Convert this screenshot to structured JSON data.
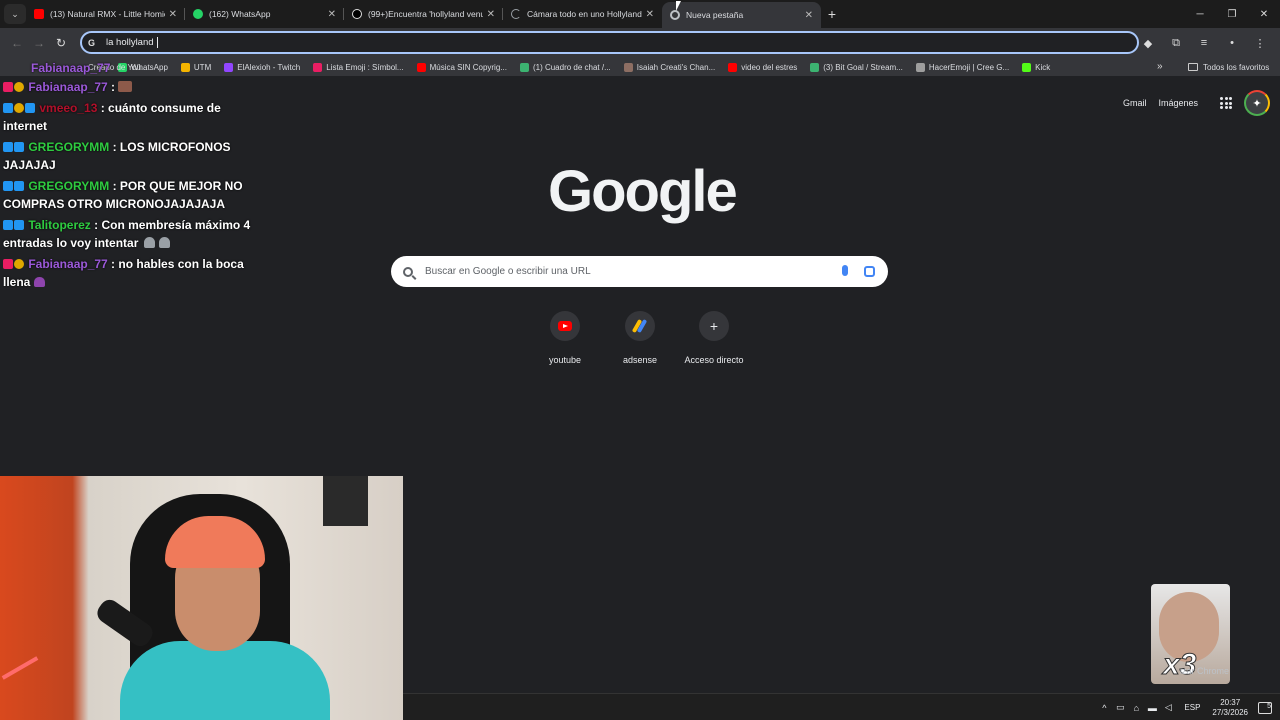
{
  "tabs": [
    {
      "label": "(13) Natural RMX - Little Homie",
      "icon": "youtube-icon",
      "color": "#ff0000"
    },
    {
      "label": "(162) WhatsApp",
      "icon": "whatsapp-icon",
      "color": "#25d366"
    },
    {
      "label": "(99+)Encuentra 'hollyland venu",
      "icon": "tiktok-icon",
      "color": "#ffffff"
    },
    {
      "label": "Cámara todo en uno Hollyland",
      "icon": "loading-icon",
      "color": "#9aa0a6"
    },
    {
      "label": "Nueva pestaña",
      "icon": "chrome-icon",
      "color": "#bdc1c6"
    }
  ],
  "omnibox": {
    "value": "la hollyland"
  },
  "bookmarks": [
    {
      "label": "WhatsApp",
      "color": "#25d366"
    },
    {
      "label": "UTM",
      "color": "#f4b400"
    },
    {
      "label": "ElAlexioh - Twitch",
      "color": "#9146ff"
    },
    {
      "label": "Lista Emoji : Símbol...",
      "color": "#e91e63"
    },
    {
      "label": "Música SIN Copyrig...",
      "color": "#ff0000"
    },
    {
      "label": "(1) Cuadro de chat /...",
      "color": "#3cb371"
    },
    {
      "label": "Isaiah Creati's Chan...",
      "color": "#8d6e63"
    },
    {
      "label": "video del estres",
      "color": "#ff0000"
    },
    {
      "label": "(3) Bit Goal / Stream...",
      "color": "#3cb371"
    },
    {
      "label": "HacerEmoji | Cree G...",
      "color": "#9e9e9e"
    },
    {
      "label": "Kick",
      "color": "#53fc18"
    }
  ],
  "bookmark_chat_prefix": "Fabianaap_77",
  "bookmark_chat_trail": "Creado de You...",
  "all_bookmarks": "Todos los favoritos",
  "ntp": {
    "gmail": "Gmail",
    "images": "Imágenes",
    "logo": "Google",
    "search_placeholder": "Buscar en Google o escribir una URL",
    "shortcuts": [
      {
        "label": "youtube"
      },
      {
        "label": "adsense"
      },
      {
        "label": "Acceso directo",
        "symbol": "+"
      }
    ]
  },
  "chat": [
    {
      "user": "Fabianaap_77",
      "user_color": "#9b59d9",
      "text": " : "
    },
    {
      "user": "vmeeo_13",
      "user_color": "#b0102a",
      "text": " : cuánto consume de internet"
    },
    {
      "user": "GREGORYMM",
      "user_color": "#2ecc40",
      "text": " : LOS MICROFONOS JAJAJAJ"
    },
    {
      "user": "GREGORYMM",
      "user_color": "#2ecc40",
      "text": " : POR QUE MEJOR NO COMPRAS OTRO MICRONOJAJAJAJA"
    },
    {
      "user": "Talitoperez",
      "user_color": "#2ecc40",
      "text": " : Con membresía máximo 4 entradas lo voy intentar "
    },
    {
      "user": "Fabianaap_77",
      "user_color": "#9b59d9",
      "text": " : no hables con la boca llena "
    }
  ],
  "sticker_text": "x3",
  "chrome_notice": "izar Chrome",
  "taskbar": {
    "lang": "ESP",
    "time": "20:37",
    "date": "27/3/2026",
    "notif_count": "5"
  }
}
